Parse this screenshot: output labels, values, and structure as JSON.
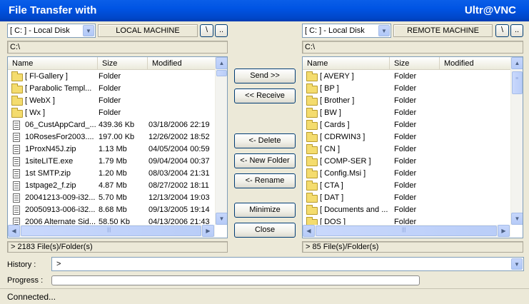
{
  "window": {
    "title_left": "File Transfer with",
    "title_right": "Ultr@VNC"
  },
  "local": {
    "drive": "[ C: ] - Local Disk",
    "machine_label": "LOCAL MACHINE",
    "root_button": "\\",
    "up_button": "..",
    "path": "C:\\",
    "columns": [
      "Name",
      "Size",
      "Modified"
    ],
    "files": [
      {
        "icon": "folder-icon",
        "name": "[ Fl-Gallery ]",
        "size": "Folder",
        "modified": ""
      },
      {
        "icon": "folder-icon",
        "name": "[ Parabolic Templ...",
        "size": "Folder",
        "modified": ""
      },
      {
        "icon": "folder-icon",
        "name": "[ WebX ]",
        "size": "Folder",
        "modified": ""
      },
      {
        "icon": "folder-icon",
        "name": "[ Wx ]",
        "size": "Folder",
        "modified": ""
      },
      {
        "icon": "file-icon",
        "name": "06_CustAppCard_...",
        "size": "439.36 Kb",
        "modified": "03/18/2006 22:19"
      },
      {
        "icon": "file-icon",
        "name": "10RosesFor2003....",
        "size": "197.00 Kb",
        "modified": "12/26/2002 18:52"
      },
      {
        "icon": "file-icon",
        "name": "1ProxN45J.zip",
        "size": "1.13 Mb",
        "modified": "04/05/2004 00:59"
      },
      {
        "icon": "file-icon",
        "name": "1siteLITE.exe",
        "size": "1.79 Mb",
        "modified": "09/04/2004 00:37"
      },
      {
        "icon": "file-icon",
        "name": "1st SMTP.zip",
        "size": "1.20 Mb",
        "modified": "08/03/2004 21:31"
      },
      {
        "icon": "file-icon",
        "name": "1stpage2_f.zip",
        "size": "4.87 Mb",
        "modified": "08/27/2002 18:11"
      },
      {
        "icon": "file-icon",
        "name": "20041213-009-i32...",
        "size": "5.70 Mb",
        "modified": "12/13/2004 19:03"
      },
      {
        "icon": "file-icon",
        "name": "20050913-006-i32...",
        "size": "8.68 Mb",
        "modified": "09/13/2005 19:14"
      },
      {
        "icon": "file-icon",
        "name": "2006 Alternate Sid...",
        "size": "58.50 Kb",
        "modified": "04/13/2006 21:43"
      }
    ],
    "status": "> 2183 File(s)/Folder(s)"
  },
  "remote": {
    "drive": "[ C: ] - Local Disk",
    "machine_label": "REMOTE MACHINE",
    "root_button": "\\",
    "up_button": "..",
    "path": "C:\\",
    "columns": [
      "Name",
      "Size",
      "Modified"
    ],
    "files": [
      {
        "icon": "folder-icon",
        "name": "[ AVERY ]",
        "size": "Folder",
        "modified": ""
      },
      {
        "icon": "folder-icon",
        "name": "[ BP ]",
        "size": "Folder",
        "modified": ""
      },
      {
        "icon": "folder-icon",
        "name": "[ Brother ]",
        "size": "Folder",
        "modified": ""
      },
      {
        "icon": "folder-icon",
        "name": "[ BW ]",
        "size": "Folder",
        "modified": ""
      },
      {
        "icon": "folder-icon",
        "name": "[ Cards ]",
        "size": "Folder",
        "modified": ""
      },
      {
        "icon": "folder-icon",
        "name": "[ CDRWIN3 ]",
        "size": "Folder",
        "modified": ""
      },
      {
        "icon": "folder-icon",
        "name": "[ CN ]",
        "size": "Folder",
        "modified": ""
      },
      {
        "icon": "folder-icon",
        "name": "[ COMP-SER ]",
        "size": "Folder",
        "modified": ""
      },
      {
        "icon": "folder-icon",
        "name": "[ Config.Msi ]",
        "size": "Folder",
        "modified": ""
      },
      {
        "icon": "folder-icon",
        "name": "[ CTA ]",
        "size": "Folder",
        "modified": ""
      },
      {
        "icon": "folder-icon",
        "name": "[ DAT ]",
        "size": "Folder",
        "modified": ""
      },
      {
        "icon": "folder-icon",
        "name": "[ Documents and ...",
        "size": "Folder",
        "modified": ""
      },
      {
        "icon": "folder-icon",
        "name": "[ DOS ]",
        "size": "Folder",
        "modified": ""
      }
    ],
    "status": "> 85 File(s)/Folder(s)"
  },
  "actions": {
    "send": "Send >>",
    "receive": "<< Receive",
    "delete": "<- Delete",
    "new_folder": "<- New Folder",
    "rename": "<- Rename",
    "minimize": "Minimize",
    "close": "Close"
  },
  "history": {
    "label": "History :",
    "value": ">"
  },
  "progress": {
    "label": "Progress :",
    "value": 0
  },
  "status_bar": {
    "text": "Connected..."
  },
  "colors": {
    "titlebar": "#0054e3",
    "face": "#ece9d8",
    "folder": "#f4dc6e",
    "button_border": "#003c74"
  }
}
